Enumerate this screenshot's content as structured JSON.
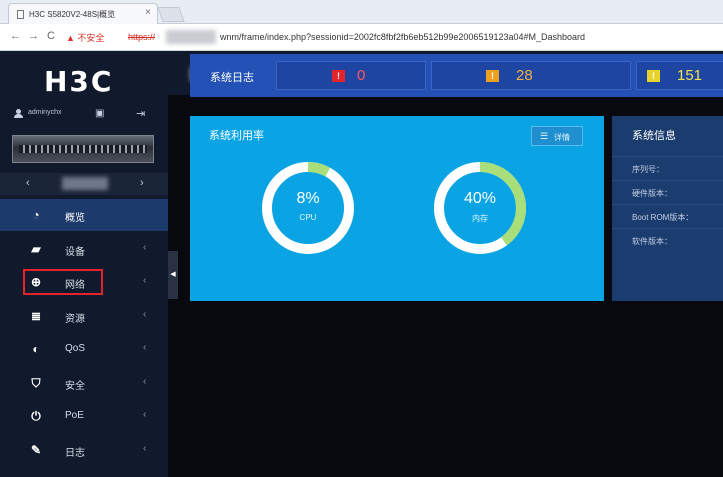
{
  "browser": {
    "tab_title": "H3C S5820V2-48S|概览",
    "tab_close": "×",
    "back": "←",
    "forward": "→",
    "reload": "C",
    "insecure_label": "▲ 不安全",
    "url_scheme": "https://",
    "url_path": "wnm/frame/index.php?sessionid=2002fc8fbf2fb6eb512b99e2006519123a04#M_Dashboard"
  },
  "sidebar": {
    "logo": "H3C",
    "username": "adminychx",
    "save_icon": "save-icon",
    "logout_icon": "logout-icon",
    "device_prev": "‹",
    "device_next": "›",
    "items": [
      {
        "label": "概览",
        "icon": "dashboard-icon",
        "glyph": "◔",
        "active": true
      },
      {
        "label": "设备",
        "icon": "device-icon",
        "glyph": "▰",
        "chevron": "‹"
      },
      {
        "label": "网络",
        "icon": "network-globe-icon",
        "glyph": "⊕",
        "chevron": "‹"
      },
      {
        "label": "资源",
        "icon": "resource-database-icon",
        "glyph": "≣",
        "chevron": "‹"
      },
      {
        "label": "QoS",
        "icon": "qos-icon",
        "glyph": "◐",
        "chevron": "‹"
      },
      {
        "label": "安全",
        "icon": "security-shield-icon",
        "glyph": "⛉",
        "chevron": "‹"
      },
      {
        "label": "PoE",
        "icon": "poe-power-icon",
        "glyph": "⏻",
        "chevron": "‹"
      },
      {
        "label": "日志",
        "icon": "log-icon",
        "glyph": "✎",
        "chevron": "‹"
      }
    ],
    "collapse_glyph": "◀"
  },
  "log_bar": {
    "title": "系统日志",
    "counts": [
      {
        "value": "0",
        "severity": "critical",
        "color": "#e4232b",
        "text_color": "#ff5a5a"
      },
      {
        "value": "28",
        "severity": "warning",
        "color": "#f0a020",
        "text_color": "#f0b040"
      },
      {
        "value": "151",
        "severity": "info",
        "color": "#e6d42a",
        "text_color": "#f2e14a"
      }
    ]
  },
  "util": {
    "title": "系统利用率",
    "detail_icon": "☰",
    "detail_label": "详情",
    "gauges": [
      {
        "name": "CPU",
        "percent": 8,
        "value_text": "8%",
        "label": "CPU"
      },
      {
        "name": "memory",
        "percent": 40,
        "value_text": "40%",
        "label": "内存"
      }
    ]
  },
  "info": {
    "title": "系统信息",
    "rows": [
      "序列号：",
      "硬件版本：",
      "Boot ROM版本：",
      "软件版本："
    ]
  },
  "colors": {
    "sidebar_bg": "#111a2c",
    "active_nav": "#1d3a6c",
    "log_bar": "#2351b5",
    "util_card": "#0aa4e5",
    "info_card": "#1b3c6e",
    "gauge_track": "#ffffff",
    "gauge_fill": "#a9de7a",
    "highlight_box": "#e4232b"
  }
}
